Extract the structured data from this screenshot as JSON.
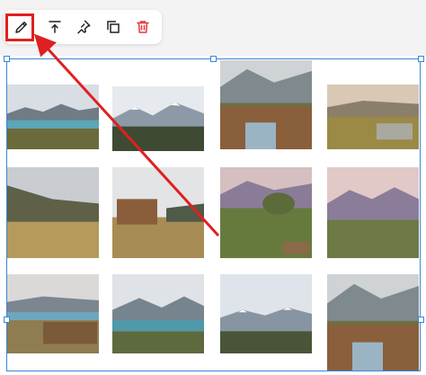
{
  "toolbar": {
    "buttons": [
      {
        "name": "edit",
        "icon": "pencil-icon",
        "color": "#222222"
      },
      {
        "name": "move-to-top",
        "icon": "align-top-icon",
        "color": "#222222"
      },
      {
        "name": "pin",
        "icon": "pin-icon",
        "color": "#222222"
      },
      {
        "name": "duplicate",
        "icon": "copy-icon",
        "color": "#222222"
      },
      {
        "name": "delete",
        "icon": "trash-icon",
        "color": "#e0383e"
      }
    ]
  },
  "annotation": {
    "highlight_color": "#e02020",
    "arrow_color": "#e02020"
  },
  "selection": {
    "frame_color": "#3a86d6"
  },
  "gallery": {
    "columns": 4,
    "rows": 3,
    "tiles": [
      {
        "name": "lake-mountains",
        "theme": "lake"
      },
      {
        "name": "snowy-peaks-hills",
        "theme": "peaks"
      },
      {
        "name": "wooden-cabin-mountain",
        "theme": "cabin-close"
      },
      {
        "name": "golden-valley-steps",
        "theme": "valley"
      },
      {
        "name": "grassy-hillside",
        "theme": "hillside"
      },
      {
        "name": "cabin-in-grass",
        "theme": "cabin-grass"
      },
      {
        "name": "purple-mountains-bush",
        "theme": "purple-bush"
      },
      {
        "name": "purple-mountains-field",
        "theme": "purple-field"
      },
      {
        "name": "cabin-by-lake",
        "theme": "cabin-lake"
      },
      {
        "name": "lake-and-mountains",
        "theme": "lake2"
      },
      {
        "name": "snowy-range-meadow",
        "theme": "peaks2"
      },
      {
        "name": "cabin-mountain-vista",
        "theme": "cabin-close"
      }
    ]
  }
}
